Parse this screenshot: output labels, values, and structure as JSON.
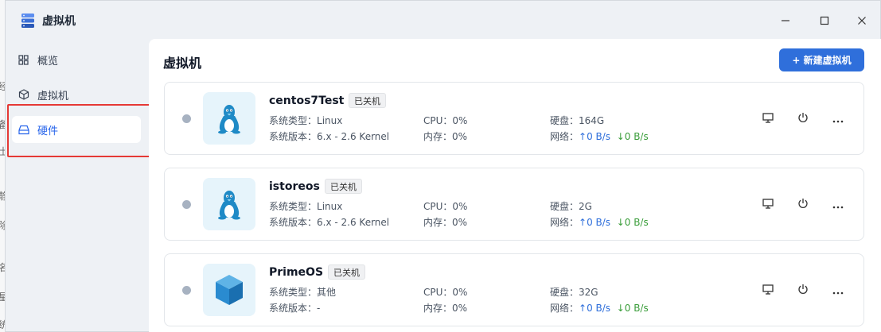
{
  "window": {
    "title": "虚拟机"
  },
  "bg_strip_chars": [
    "经",
    "备",
    "士",
    "静",
    "除",
    "名",
    "星",
    "统"
  ],
  "sidebar": {
    "items": [
      {
        "label": "概览",
        "icon": "grid-icon",
        "active": false
      },
      {
        "label": "虚拟机",
        "icon": "cube-icon",
        "active": false
      },
      {
        "label": "硬件",
        "icon": "drive-icon",
        "active": true
      }
    ]
  },
  "main": {
    "title": "虚拟机",
    "new_button": "+ 新建虚拟机"
  },
  "vms": [
    {
      "name": "centos7Test",
      "state": "已关机",
      "os_icon": "linux-tux-icon",
      "type_label": "系统类型：",
      "type": "Linux",
      "version_label": "系统版本：",
      "version": "6.x - 2.6 Kernel",
      "cpu_label": "CPU：",
      "cpu": "0%",
      "mem_label": "内存：",
      "mem": "0%",
      "disk_label": "硬盘：",
      "disk": "164G",
      "net_label": "网络：",
      "net_up": "↑0 B/s",
      "net_down": "↓0 B/s"
    },
    {
      "name": "istoreos",
      "state": "已关机",
      "os_icon": "linux-tux-icon",
      "type_label": "系统类型：",
      "type": "Linux",
      "version_label": "系统版本：",
      "version": "6.x - 2.6 Kernel",
      "cpu_label": "CPU：",
      "cpu": "0%",
      "mem_label": "内存：",
      "mem": "0%",
      "disk_label": "硬盘：",
      "disk": "2G",
      "net_label": "网络：",
      "net_up": "↑0 B/s",
      "net_down": "↓0 B/s"
    },
    {
      "name": "PrimeOS",
      "state": "已关机",
      "os_icon": "box-3d-icon",
      "type_label": "系统类型：",
      "type": "其他",
      "version_label": "系统版本：",
      "version": "-",
      "cpu_label": "CPU：",
      "cpu": "0%",
      "mem_label": "内存：",
      "mem": "0%",
      "disk_label": "硬盘：",
      "disk": "32G",
      "net_label": "网络：",
      "net_up": "↑0 B/s",
      "net_down": "↓0 B/s"
    }
  ],
  "colors": {
    "accent": "#2f6fdb",
    "highlight": "#e53935",
    "status_off": "#a7b2c1"
  }
}
